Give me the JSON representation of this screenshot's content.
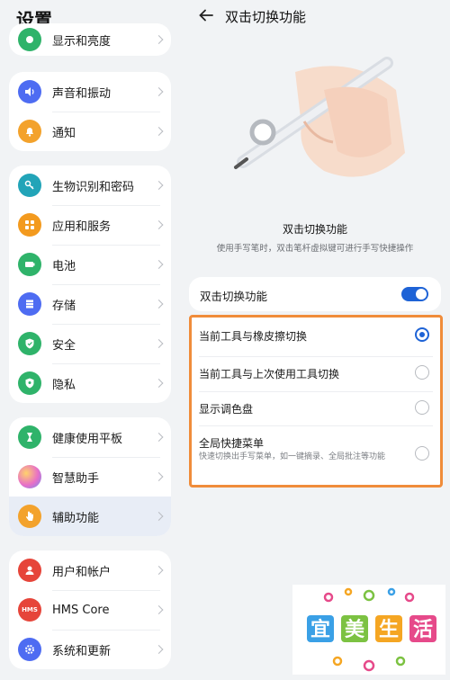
{
  "left": {
    "title": "设置",
    "groups": [
      {
        "items": [
          {
            "label": "显示和亮度",
            "icon": "display-icon",
            "color": "#2fb36a"
          }
        ]
      },
      {
        "items": [
          {
            "label": "声音和振动",
            "icon": "sound-icon",
            "color": "#4e6cf2"
          },
          {
            "label": "通知",
            "icon": "bell-icon",
            "color": "#f3a22c"
          }
        ]
      },
      {
        "items": [
          {
            "label": "生物识别和密码",
            "icon": "key-icon",
            "color": "#22a4b8"
          },
          {
            "label": "应用和服务",
            "icon": "apps-icon",
            "color": "#f39a1e"
          },
          {
            "label": "电池",
            "icon": "battery-icon",
            "color": "#2fb36a"
          },
          {
            "label": "存储",
            "icon": "storage-icon",
            "color": "#4e6cf2"
          },
          {
            "label": "安全",
            "icon": "shield-icon",
            "color": "#2fb36a"
          },
          {
            "label": "隐私",
            "icon": "privacy-icon",
            "color": "#2fb36a"
          }
        ]
      },
      {
        "items": [
          {
            "label": "健康使用平板",
            "icon": "hourglass-icon",
            "color": "#2fb36a"
          },
          {
            "label": "智慧助手",
            "icon": "assistant-icon",
            "color": "#c46ee8"
          },
          {
            "label": "辅助功能",
            "icon": "accessibility-icon",
            "color": "#f3a22c",
            "selected": true
          }
        ]
      },
      {
        "items": [
          {
            "label": "用户和帐户",
            "icon": "user-icon",
            "color": "#e6453a"
          },
          {
            "label": "HMS Core",
            "icon": "hms-icon",
            "color": "#e6453a",
            "badge": "HMS"
          },
          {
            "label": "系统和更新",
            "icon": "gear-icon",
            "color": "#4e6cf2"
          }
        ]
      }
    ]
  },
  "right": {
    "title": "双击切换功能",
    "feature_title": "双击切换功能",
    "feature_desc": "使用手写笔时，双击笔杆虚拟键可进行手写快捷操作",
    "toggle_label": "双击切换功能",
    "toggle_on": true,
    "options": [
      {
        "label": "当前工具与橡皮擦切换",
        "selected": true
      },
      {
        "label": "当前工具与上次使用工具切换",
        "selected": false
      },
      {
        "label": "显示调色盘",
        "selected": false
      },
      {
        "label": "全局快捷菜单",
        "sub": "快速切换出手写菜单，如一键摘录、全局批注等功能",
        "selected": false
      }
    ]
  },
  "watermark": {
    "chars": [
      "宜",
      "美",
      "生",
      "活"
    ]
  },
  "colors": {
    "accent": "#1e63d6",
    "highlight_border": "#f08c3a"
  }
}
